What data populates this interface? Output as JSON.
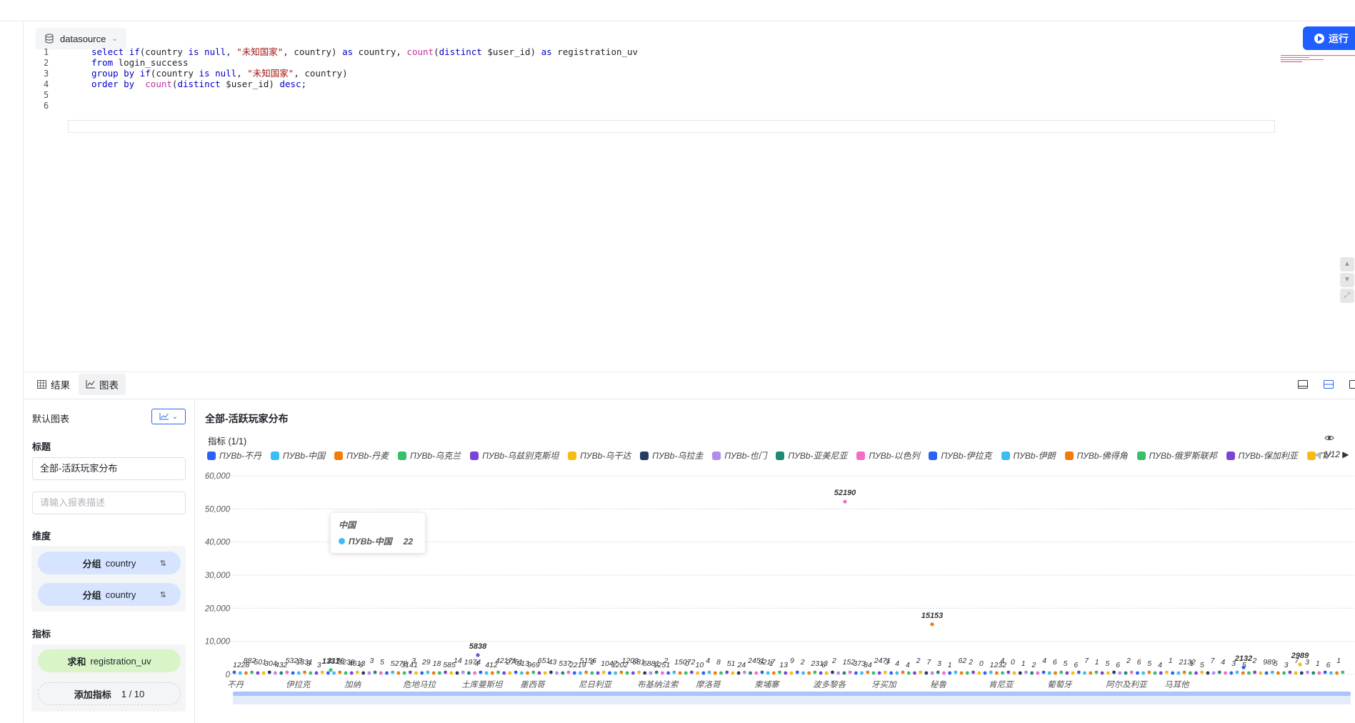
{
  "editor": {
    "datasource_label": "datasource",
    "run_label": "运行",
    "lines": [
      {
        "n": "1",
        "tokens": [
          [
            "kw",
            "select "
          ],
          [
            "kw",
            "if"
          ],
          [
            "",
            "(country "
          ],
          [
            "kw",
            "is null"
          ],
          [
            "",
            ", "
          ],
          [
            "str",
            "\"未知国家\""
          ],
          [
            "",
            ", country) "
          ],
          [
            "kw",
            "as"
          ],
          [
            "",
            " country, "
          ],
          [
            "fn",
            "count"
          ],
          [
            "",
            "("
          ],
          [
            "kw",
            "distinct"
          ],
          [
            "",
            " $user_id) "
          ],
          [
            "kw",
            "as"
          ],
          [
            "",
            " registration_uv"
          ]
        ]
      },
      {
        "n": "2",
        "tokens": [
          [
            "kw",
            "from"
          ],
          [
            "",
            " login_success"
          ]
        ]
      },
      {
        "n": "3",
        "tokens": [
          [
            "kw",
            "group by "
          ],
          [
            "kw",
            "if"
          ],
          [
            "",
            "(country "
          ],
          [
            "kw",
            "is null"
          ],
          [
            "",
            ", "
          ],
          [
            "str",
            "\"未知国家\""
          ],
          [
            "",
            ", country)"
          ]
        ]
      },
      {
        "n": "4",
        "tokens": [
          [
            "kw",
            "order by  "
          ],
          [
            "fn",
            "count"
          ],
          [
            "",
            "("
          ],
          [
            "kw",
            "distinct"
          ],
          [
            "",
            " $user_id) "
          ],
          [
            "kw",
            "desc"
          ],
          [
            "",
            ";"
          ]
        ]
      },
      {
        "n": "5",
        "tokens": []
      },
      {
        "n": "6",
        "tokens": []
      }
    ]
  },
  "tabs": [
    {
      "label": "结果",
      "icon": "table-icon",
      "active": false
    },
    {
      "label": "图表",
      "icon": "line-chart-icon",
      "active": true
    }
  ],
  "config": {
    "default_chart": "默认图表",
    "title_heading": "标题",
    "title_value": "全部-活跃玩家分布",
    "desc_placeholder": "请输入报表描述",
    "dimension_heading": "维度",
    "dimensions": [
      {
        "prefix": "分组",
        "field": "country"
      },
      {
        "prefix": "分组",
        "field": "country"
      }
    ],
    "metric_heading": "指标",
    "metrics": [
      {
        "prefix": "求和",
        "field": "registration_uv"
      }
    ],
    "add_metric_label": "添加指标",
    "add_metric_count": "1 / 10"
  },
  "chart_header": {
    "title": "全部-活跃玩家分布",
    "metric_label": "指标 (1/1)",
    "legend_page": "1/12"
  },
  "tooltip": {
    "title": "中国",
    "series": "ПУВb-中国",
    "value": "22"
  },
  "chart_data": {
    "type": "scatter",
    "title": "全部-活跃玩家分布",
    "ylim": [
      0,
      60000
    ],
    "yticks": [
      "60,000",
      "50,000",
      "40,000",
      "30,000",
      "20,000",
      "10,000",
      "0"
    ],
    "grid": true,
    "legend_position": "top",
    "x_tick_labels": [
      "不丹",
      "伊拉克",
      "加纳",
      "危地马拉",
      "土库曼斯坦",
      "墨西哥",
      "尼日利亚",
      "布基纳法索",
      "摩洛哥",
      "柬埔寨",
      "波多黎各",
      "牙买加",
      "秘鲁",
      "肯尼亚",
      "葡萄牙",
      "阿尔及利亚",
      "马耳他"
    ],
    "legend": [
      {
        "name": "ПУВb-不丹",
        "color": "#2a63f2"
      },
      {
        "name": "ПУВb-中国",
        "color": "#3bbcf2"
      },
      {
        "name": "ПУВb-丹麦",
        "color": "#f07c0c"
      },
      {
        "name": "ПУВb-乌克兰",
        "color": "#36c06a"
      },
      {
        "name": "ПУВb-乌兹别克斯坦",
        "color": "#7b44d6"
      },
      {
        "name": "ПУВb-乌干达",
        "color": "#f5bd12"
      },
      {
        "name": "ПУВb-乌拉圭",
        "color": "#283c63"
      },
      {
        "name": "ПУВb-也门",
        "color": "#b38bea"
      },
      {
        "name": "ПУВb-亚美尼亚",
        "color": "#1d8a72"
      },
      {
        "name": "ПУВb-以色列",
        "color": "#f36cc5"
      },
      {
        "name": "ПУВb-伊拉克",
        "color": "#2a63f2"
      },
      {
        "name": "ПУВb-伊朗",
        "color": "#3bbcf2"
      },
      {
        "name": "ПУВb-佛得角",
        "color": "#f07c0c"
      },
      {
        "name": "ПУВb-俄罗斯联邦",
        "color": "#36c06a"
      },
      {
        "name": "ПУВb-保加利亚",
        "color": "#7b44d6"
      },
      {
        "name": "ПУ",
        "color": "#f5bd12"
      }
    ],
    "highlighted_points": [
      {
        "label": "52190",
        "value": 52190,
        "color": "#f36cc5"
      },
      {
        "label": "15153",
        "value": 15153,
        "color": "#f07c0c"
      },
      {
        "label": "5838",
        "value": 5838,
        "color": "#7b44d6"
      },
      {
        "label": "2989",
        "value": 2989,
        "color": "#f5bd12"
      },
      {
        "label": "2132",
        "value": 2132,
        "color": "#2a63f2"
      },
      {
        "label": "1331",
        "value": 1331,
        "color": "#36c06a"
      }
    ],
    "small_value_labels": [
      "1228",
      "882",
      "501",
      "304",
      "432",
      "5323",
      "1331",
      "8",
      "3",
      "3176",
      "8238",
      "4613",
      "6",
      "3",
      "5",
      "5278",
      "3141",
      "3",
      "29",
      "18",
      "585",
      "14",
      "1974",
      "4",
      "412",
      "42171",
      "2751",
      "513",
      "969",
      "651",
      "43",
      "537",
      "2219",
      "5156",
      "2",
      "1047",
      "1202",
      "1203",
      "681",
      "5881",
      "1251",
      "2",
      "15072",
      "0",
      "10",
      "4",
      "8",
      "51",
      "24",
      "2451",
      "5217",
      "1",
      "13",
      "9",
      "2",
      "2313",
      "6",
      "2",
      "152",
      "373",
      "84",
      "2471",
      "3",
      "4",
      "4",
      "2",
      "7",
      "3",
      "1",
      "62",
      "2",
      "0",
      "1232",
      "4",
      "0",
      "1",
      "2",
      "4",
      "6",
      "5",
      "6",
      "7",
      "1",
      "5",
      "6",
      "2",
      "6",
      "5",
      "4",
      "1",
      "2132",
      "1",
      "5",
      "7",
      "4",
      "3",
      "5",
      "2",
      "989",
      "5",
      "3",
      "7",
      "3",
      "1",
      "6",
      "1"
    ]
  }
}
